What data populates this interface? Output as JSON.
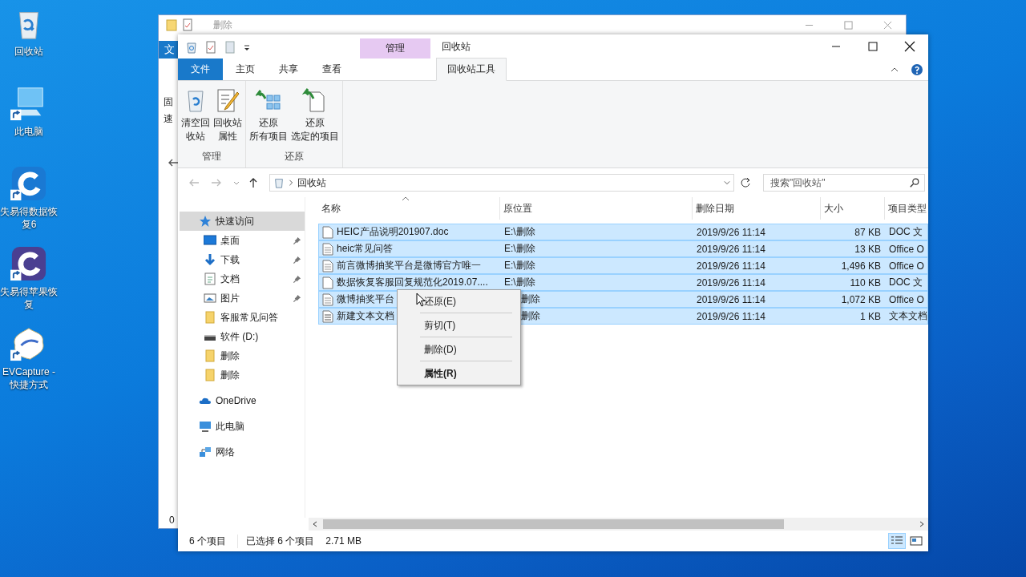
{
  "desktop": {
    "icons": [
      {
        "label": "回收站",
        "kind": "recycle",
        "shortcut": false
      },
      {
        "label": "此电脑",
        "kind": "computer",
        "shortcut": true
      },
      {
        "label": "失易得数据恢复6",
        "kind": "recover-blue",
        "shortcut": true
      },
      {
        "label": "失易得苹果恢复",
        "kind": "recover-purple",
        "shortcut": true
      },
      {
        "label": "EVCapture - 快捷方式",
        "kind": "flower",
        "shortcut": true
      }
    ]
  },
  "back_window": {
    "title": "删除",
    "tab_fragment": "文",
    "ribbon_fragments": [
      "固",
      "速"
    ],
    "pane_fragment": "0"
  },
  "window": {
    "title": "回收站",
    "context_tab": "管理",
    "tabs": [
      {
        "label": "文件",
        "kind": "file",
        "selected": false
      },
      {
        "label": "主页",
        "kind": "plain",
        "selected": false
      },
      {
        "label": "共享",
        "kind": "plain",
        "selected": false
      },
      {
        "label": "查看",
        "kind": "plain",
        "selected": false
      },
      {
        "label": "回收站工具",
        "kind": "context",
        "selected": true
      }
    ],
    "ribbon": {
      "groups": [
        {
          "label": "管理",
          "buttons": [
            {
              "lines": [
                "清空回",
                "收站"
              ],
              "kind": "bin"
            },
            {
              "lines": [
                "回收站",
                "属性"
              ],
              "kind": "props"
            }
          ]
        },
        {
          "label": "还原",
          "buttons": [
            {
              "lines": [
                "还原",
                "所有项目"
              ],
              "kind": "restore-all"
            },
            {
              "lines": [
                "还原",
                "选定的项目"
              ],
              "kind": "restore-one"
            }
          ]
        }
      ]
    },
    "address": {
      "path": "回收站"
    },
    "search": {
      "placeholder": "搜索\"回收站\""
    },
    "nav": [
      {
        "label": "快速访问",
        "kind": "star",
        "selected": true,
        "children": [
          {
            "label": "桌面",
            "kind": "desktop",
            "pinned": true
          },
          {
            "label": "下载",
            "kind": "download",
            "pinned": true
          },
          {
            "label": "文档",
            "kind": "document",
            "pinned": true
          },
          {
            "label": "图片",
            "kind": "picture",
            "pinned": true
          },
          {
            "label": "客服常见问答",
            "kind": "folder",
            "pinned": false
          },
          {
            "label": "软件 (D:)",
            "kind": "drive",
            "pinned": false
          },
          {
            "label": "删除",
            "kind": "folder",
            "pinned": false
          },
          {
            "label": "删除",
            "kind": "folder",
            "pinned": false
          }
        ]
      },
      {
        "label": "OneDrive",
        "kind": "cloud",
        "selected": false
      },
      {
        "label": "此电脑",
        "kind": "computer",
        "selected": false
      },
      {
        "label": "网络",
        "kind": "network",
        "selected": false
      }
    ],
    "table": {
      "columns": [
        "名称",
        "原位置",
        "删除日期",
        "大小",
        "项目类型"
      ],
      "rows": [
        {
          "name": "HEIC产品说明201907.doc",
          "location": "E:\\删除",
          "date": "2019/9/26 11:14",
          "size": "87 KB",
          "type": "DOC 文",
          "kind": "blank",
          "selected": true
        },
        {
          "name": "heic常见问答",
          "location": "E:\\删除",
          "date": "2019/9/26 11:14",
          "size": "13 KB",
          "type": "Office O",
          "kind": "lines",
          "selected": true
        },
        {
          "name": "前言微博抽奖平台是微博官方唯一",
          "location": "E:\\删除",
          "date": "2019/9/26 11:14",
          "size": "1,496 KB",
          "type": "Office O",
          "kind": "lines",
          "selected": true
        },
        {
          "name": "数据恢复客服回复规范化2019.07....",
          "location": "E:\\删除",
          "date": "2019/9/26 11:14",
          "size": "110 KB",
          "type": "DOC 文",
          "kind": "blank",
          "selected": true
        },
        {
          "name": "微博抽奖平台",
          "location": "删除",
          "date": "2019/9/26 11:14",
          "size": "1,072 KB",
          "type": "Office O",
          "kind": "lines",
          "selected": true
        },
        {
          "name": "新建文本文档",
          "location": "删除",
          "date": "2019/9/26 11:14",
          "size": "1 KB",
          "type": "文本文档",
          "kind": "text",
          "selected": true
        }
      ]
    },
    "context_menu": {
      "items": [
        {
          "label": "还原(E)",
          "default": false
        },
        {
          "label": "剪切(T)",
          "default": false
        },
        {
          "label": "删除(D)",
          "default": false
        },
        {
          "label": "属性(R)",
          "default": true
        }
      ]
    },
    "status_bar": {
      "count": "6 个项目",
      "selection": "已选择 6 个项目",
      "size": "2.71 MB",
      "views": [
        {
          "kind": "details",
          "selected": true
        },
        {
          "kind": "tiles",
          "selected": false
        }
      ]
    }
  }
}
